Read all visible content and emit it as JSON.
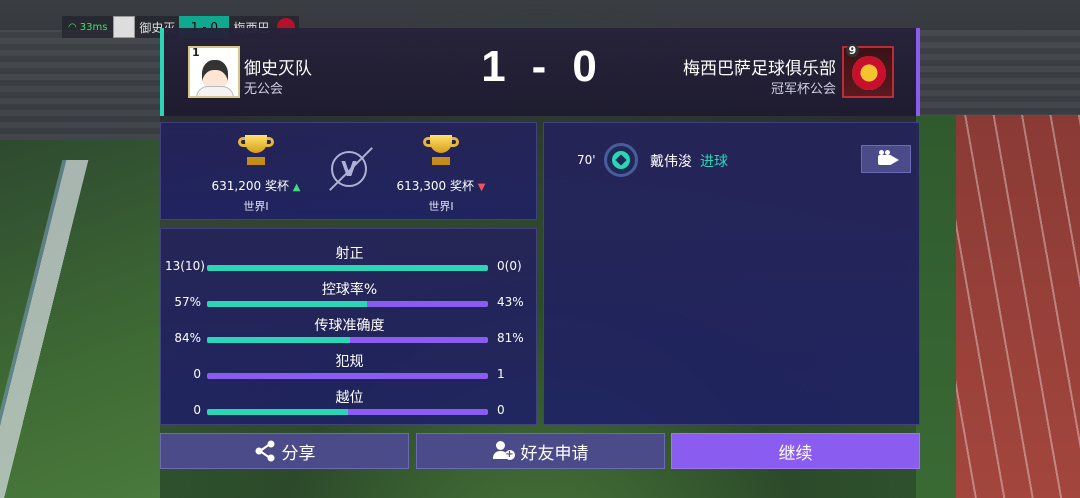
{
  "hud": {
    "ping": "33ms",
    "home_name": "御史灭",
    "score": "1 - 0",
    "away_name": "梅西巴"
  },
  "header": {
    "home_rank": "1",
    "home_team": "御史灭队",
    "home_guild": "无公会",
    "home_score": "1",
    "dash": "-",
    "away_score": "0",
    "away_rank": "9",
    "away_team": "梅西巴萨足球俱乐部",
    "away_guild": "冠军杯公会"
  },
  "trophies": {
    "home_value": "631,200 奖杯",
    "home_trend": "up",
    "home_region": "世界I",
    "vs_label": "V",
    "away_value": "613,300 奖杯",
    "away_trend": "down",
    "away_region": "世界I"
  },
  "stats": [
    {
      "label": "射正",
      "home": "13(10)",
      "away": "0(0)",
      "home_share": 1.0
    },
    {
      "label": "控球率%",
      "home": "57%",
      "away": "43%",
      "home_share": 0.57
    },
    {
      "label": "传球准确度",
      "home": "84%",
      "away": "81%",
      "home_share": 0.51
    },
    {
      "label": "犯规",
      "home": "0",
      "away": "1",
      "home_share": 0.0
    },
    {
      "label": "越位",
      "home": "0",
      "away": "0",
      "home_share": 0.5
    }
  ],
  "events": [
    {
      "minute": "70'",
      "player": "戴伟浚",
      "type": "进球"
    }
  ],
  "buttons": {
    "share": "分享",
    "friend_request": "好友申请",
    "continue": "继续"
  },
  "colors": {
    "home_accent": "#2ad6b6",
    "away_accent": "#8a5cf0",
    "trend_up": "#3de07a",
    "trend_down": "#ff4d5e"
  },
  "icons": [
    "wifi-icon",
    "trophy-icon",
    "vs-icon",
    "ball-icon",
    "video-icon",
    "share-icon",
    "add-friend-icon"
  ]
}
